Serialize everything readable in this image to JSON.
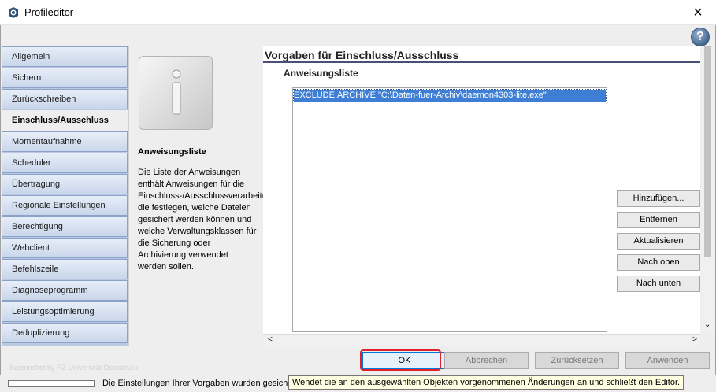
{
  "window": {
    "title": "Profileditor",
    "close": "×",
    "help": "?"
  },
  "sidebar": {
    "items": [
      {
        "label": "Allgemein"
      },
      {
        "label": "Sichern"
      },
      {
        "label": "Zurückschreiben"
      },
      {
        "label": "Einschluss/Ausschluss",
        "active": true
      },
      {
        "label": "Momentaufnahme"
      },
      {
        "label": "Scheduler"
      },
      {
        "label": "Übertragung"
      },
      {
        "label": "Regionale Einstellungen"
      },
      {
        "label": "Berechtigung"
      },
      {
        "label": "Webclient"
      },
      {
        "label": "Befehlszeile"
      },
      {
        "label": "Diagnoseprogramm"
      },
      {
        "label": "Leistungsoptimierung"
      },
      {
        "label": "Deduplizierung"
      }
    ]
  },
  "info": {
    "title": "Anweisungsliste",
    "text": "Die Liste der Anweisungen enthält Anweisungen für die Einschluss-/Ausschlussverarbeitung, die festlegen, welche Dateien gesichert werden können und welche Verwaltungsklassen für die Sicherung oder Archivierung verwendet werden sollen."
  },
  "main": {
    "section_title": "Vorgaben für Einschluss/Ausschluss",
    "list_title": "Anweisungsliste",
    "list_items": [
      "EXCLUDE.ARCHIVE \"C:\\Daten-fuer-Archiv\\daemon4303-lite.exe\""
    ],
    "buttons": {
      "add": "Hinzufügen...",
      "remove": "Entfernen",
      "update": "Aktualisieren",
      "up": "Nach oben",
      "down": "Nach unten"
    }
  },
  "scroll": {
    "left": "<",
    "right": ">",
    "down": "⌄"
  },
  "footer": {
    "watermark": "Screenshot by RZ Universität Osnabrück",
    "ok": "OK",
    "cancel": "Abbrechen",
    "reset": "Zurücksetzen",
    "apply": "Anwenden",
    "status_text": "Die Einstellungen Ihrer Vorgaben wurden gesiche",
    "tooltip": "Wendet die an den ausgewählten Objekten vorgenommenen Änderungen an und schließt den Editor."
  },
  "colors": {
    "accent_line": "#4a4f78",
    "selection": "#3e7fd5",
    "highlight": "#e0202a"
  }
}
